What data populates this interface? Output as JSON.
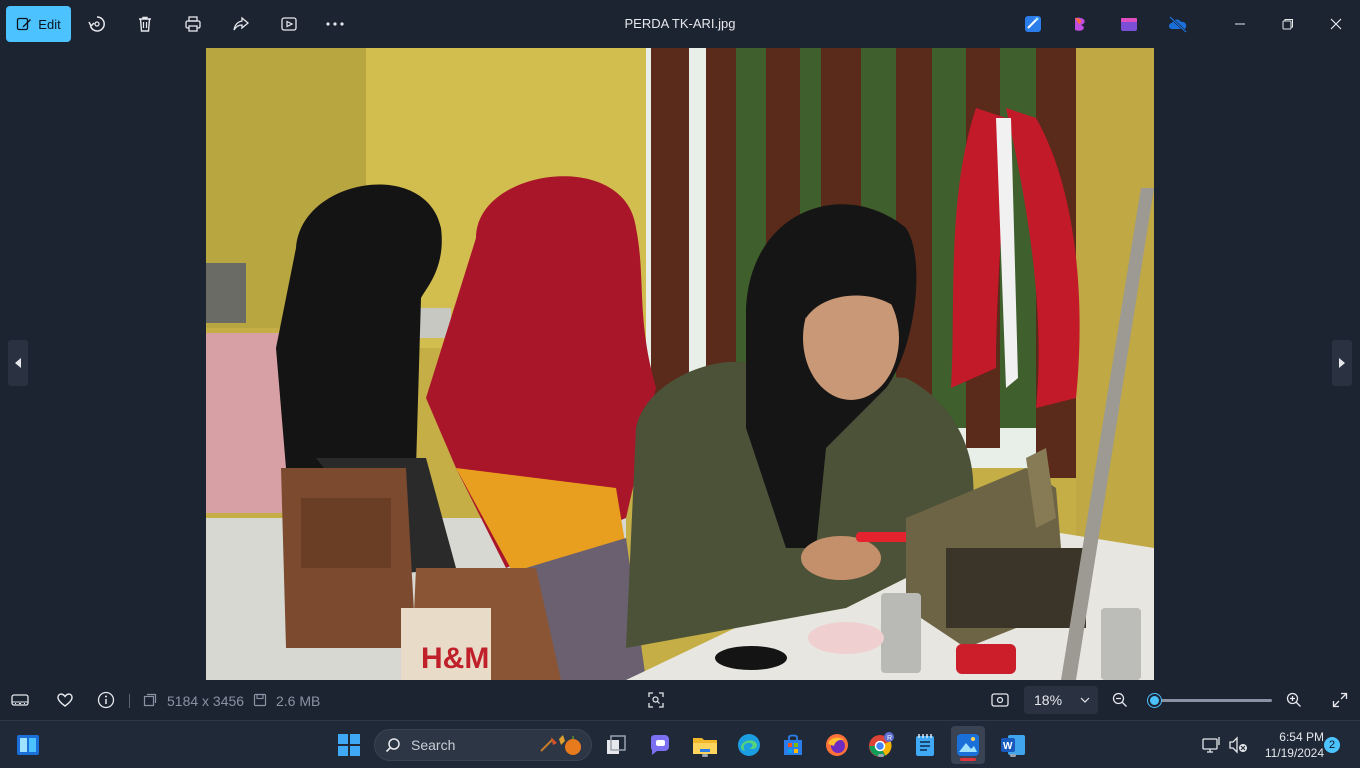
{
  "toolbar": {
    "edit_label": "Edit",
    "file_title": "PERDA TK-ARI.jpg",
    "icons": [
      "rotate-icon",
      "delete-icon",
      "print-icon",
      "share-icon",
      "slideshow-icon",
      "more-icon"
    ],
    "app_icons": [
      "photos-edit-icon",
      "clipchamp-icon",
      "clipchamp-video-icon",
      "onedrive-icon"
    ]
  },
  "photo": {
    "description_colors": {
      "wall": "#c9b346",
      "hijab_black": "#151515",
      "hijab_red": "#b0182c",
      "shirt_olive": "#4b5237",
      "shirt_yellow": "#e9a21f",
      "stool": "#7a4a2e"
    }
  },
  "infobar": {
    "dimensions": "5184 x 3456",
    "file_size": "2.6 MB",
    "zoom": "18%",
    "zoom_fraction": 0.02
  },
  "taskbar": {
    "search_placeholder": "Search",
    "time": "6:54 PM",
    "date": "11/19/2024",
    "notification_count": "2"
  },
  "colors": {
    "accent": "#4cc2ff",
    "background": "#1c2331",
    "taskbar": "#1f2937"
  }
}
